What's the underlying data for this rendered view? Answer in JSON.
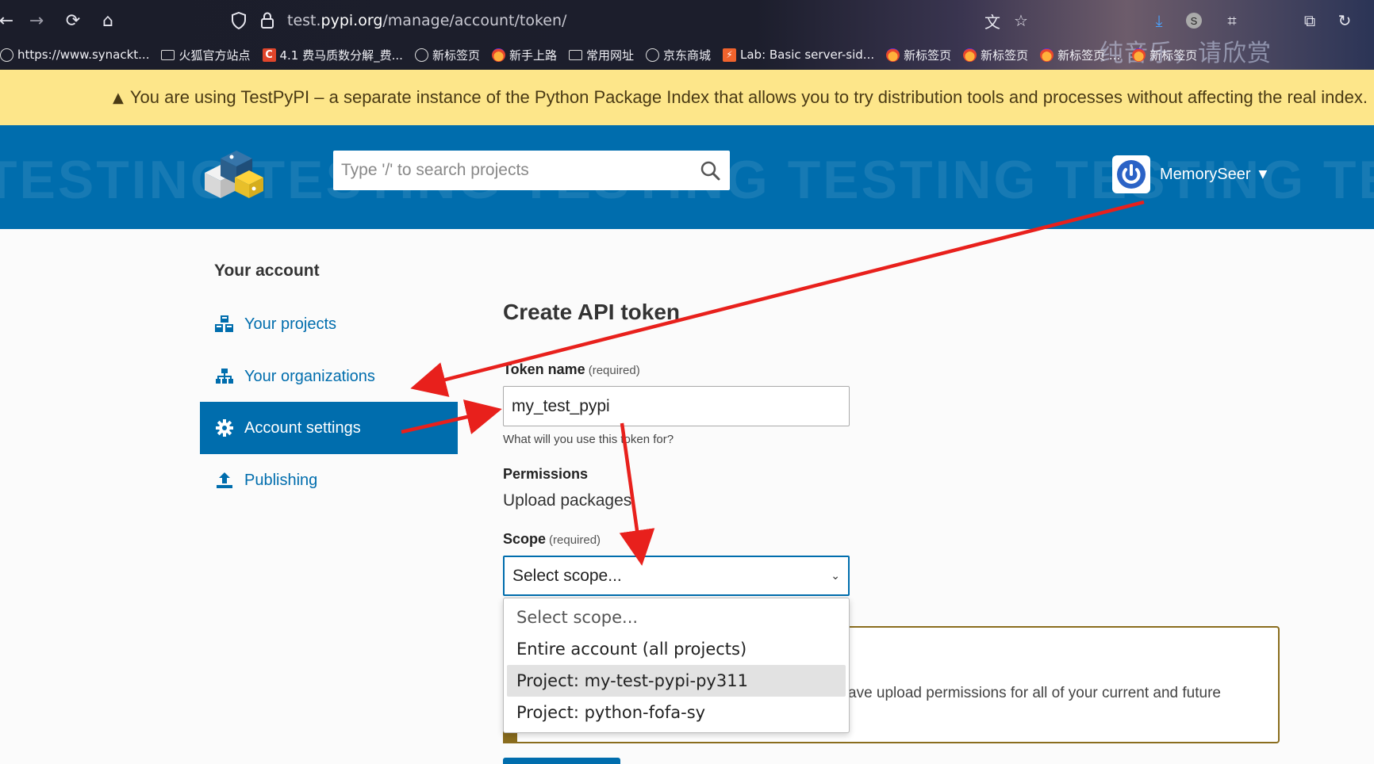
{
  "browser": {
    "url_prefix": "test.",
    "url_domain": "pypi.org",
    "url_path": "/manage/account/token/",
    "overlay_text": "纯音乐，请欣赏",
    "bookmarks": [
      {
        "icon": "globe",
        "label": "https://www.synackt..."
      },
      {
        "icon": "folder",
        "label": "火狐官方站点"
      },
      {
        "icon": "csdn",
        "label": "4.1 费马质数分解_费..."
      },
      {
        "icon": "globe",
        "label": "新标签页"
      },
      {
        "icon": "fox",
        "label": "新手上路"
      },
      {
        "icon": "folder",
        "label": "常用网址"
      },
      {
        "icon": "globe",
        "label": "京东商城"
      },
      {
        "icon": "lab",
        "label": "Lab: Basic server-sid..."
      },
      {
        "icon": "fox",
        "label": "新标签页"
      },
      {
        "icon": "fox",
        "label": "新标签页"
      },
      {
        "icon": "fox",
        "label": "新标签页 ..."
      },
      {
        "icon": "fox",
        "label": "新标签页"
      }
    ]
  },
  "banner": {
    "text": "You are using TestPyPI – a separate instance of the Python Package Index that allows you to try distribution tools and processes without affecting the real index."
  },
  "header": {
    "watermark": "TESTING TESTING TESTING TESTING TESTING TESTING TESTING",
    "search_placeholder": "Type '/' to search projects",
    "username": "MemorySeer"
  },
  "sidebar": {
    "heading": "Your account",
    "items": [
      {
        "label": "Your projects",
        "icon": "cubes-icon"
      },
      {
        "label": "Your organizations",
        "icon": "sitemap-icon"
      },
      {
        "label": "Account settings",
        "icon": "cog-icon",
        "active": true
      },
      {
        "label": "Publishing",
        "icon": "upload-icon"
      }
    ]
  },
  "main": {
    "title": "Create API token",
    "token_name_label": "Token name",
    "required": "(required)",
    "token_name_value": "my_test_pypi",
    "token_help": "What will you use this token for?",
    "permissions_label": "Permissions",
    "permissions_value": "Upload packages",
    "scope_label": "Scope",
    "scope_selected": "Select scope...",
    "scope_options": [
      "Select scope...",
      "Entire account (all projects)",
      "Project: my-test-pypi-py311",
      "Project: python-fofa-sy"
    ],
    "notice_text": "ave upload permissions for all of your current and future"
  },
  "colors": {
    "brand_blue": "#006dad",
    "banner_yellow": "#fde68a",
    "annotation_red": "#e8201c"
  }
}
